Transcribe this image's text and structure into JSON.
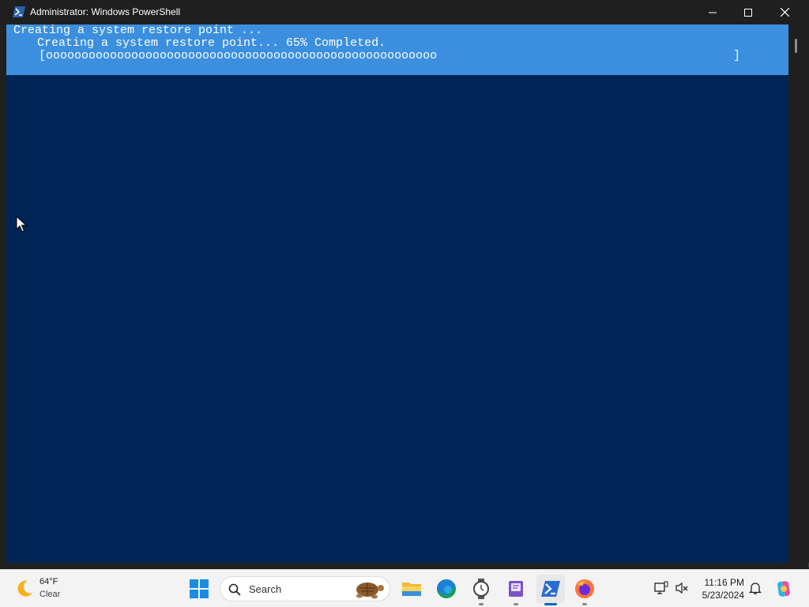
{
  "window": {
    "title": "Administrator: Windows PowerShell",
    "app_icon": "powershell-icon",
    "controls": [
      "minimize-icon",
      "maximize-icon",
      "close-icon"
    ]
  },
  "console": {
    "line1": "Creating a system restore point ...",
    "line2": "Creating a system restore point... 65% Completed.",
    "progress_bar_open": "[ooooooooooooooooooooooooooooooooooooooooooooooooooooooo",
    "progress_bar_close": "]",
    "progress_percent": 65,
    "colors": {
      "background": "#012456",
      "progress_band": "#3b8fde",
      "text": "#ffffff"
    }
  },
  "taskbar": {
    "weather": {
      "temp": "64°F",
      "condition": "Clear",
      "icon": "moon-icon"
    },
    "search": {
      "placeholder": "Search"
    },
    "apps": [
      "start-icon",
      "file-explorer-icon",
      "edge-icon",
      "clock-icon",
      "notepad-icon",
      "powershell-icon",
      "firefox-icon"
    ],
    "tray": [
      "network-icon",
      "volume-icon",
      "bell-icon",
      "copilot-icon"
    ],
    "time": "11:16 PM",
    "date": "5/23/2024",
    "accent": "#0067c0"
  }
}
